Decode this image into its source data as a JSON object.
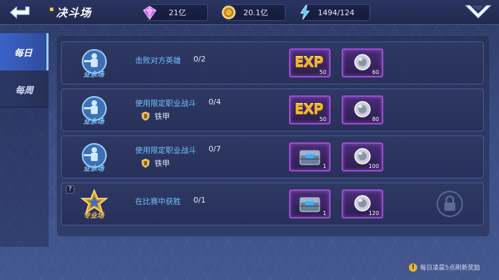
{
  "header": {
    "title": "决斗场",
    "resources": [
      {
        "icon": "diamond-icon",
        "value": "21亿"
      },
      {
        "icon": "coin-icon",
        "value": "20.1亿"
      },
      {
        "icon": "energy-icon",
        "value": "1494/124"
      }
    ]
  },
  "sidebar": {
    "tabs": [
      {
        "label": "每日",
        "active": true
      },
      {
        "label": "每周",
        "active": false
      }
    ]
  },
  "missions": [
    {
      "emblem_label": "业余场",
      "text": "击败对方英雄",
      "progress": "0/2",
      "sub_label": "",
      "rewards": [
        {
          "type": "exp",
          "label": "EXP",
          "qty": "50"
        },
        {
          "type": "silver-medal",
          "qty": "60"
        }
      ],
      "locked": false
    },
    {
      "emblem_label": "业余场",
      "text": "使用限定职业战斗",
      "progress": "0/4",
      "sub_label": "铁甲",
      "rewards": [
        {
          "type": "exp",
          "label": "EXP",
          "qty": "50"
        },
        {
          "type": "silver-medal",
          "qty": "80"
        }
      ],
      "locked": false
    },
    {
      "emblem_label": "业余场",
      "text": "使用限定职业战斗",
      "progress": "0/7",
      "sub_label": "铁甲",
      "rewards": [
        {
          "type": "supply-chest",
          "qty": "1"
        },
        {
          "type": "silver-medal",
          "qty": "100"
        }
      ],
      "locked": false
    },
    {
      "emblem_label": "专业场",
      "text": "在比赛中获胜",
      "progress": "0/1",
      "sub_label": "",
      "help_mark": "?",
      "rewards": [
        {
          "type": "supply-chest",
          "qty": "1"
        },
        {
          "type": "silver-medal",
          "qty": "120"
        }
      ],
      "locked": true
    }
  ],
  "footer": {
    "note": "每日凌晨5点刷新奖励",
    "icon_glyph": "!"
  },
  "colors": {
    "accent_blue": "#6fc3ff",
    "reward_border": "#a14bd8",
    "exp_gold": "#f2b52a",
    "active_tab": "#3c63c8"
  }
}
